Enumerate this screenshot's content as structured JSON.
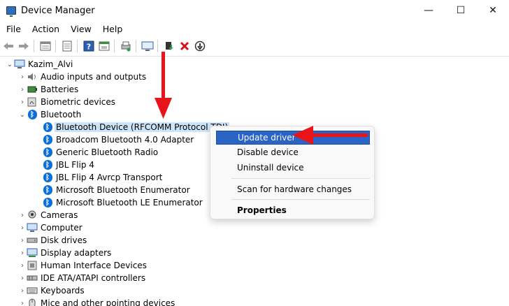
{
  "window": {
    "title": "Device Manager",
    "controls": {
      "minimize": "—",
      "maximize": "☐",
      "close": "✕"
    }
  },
  "menu": [
    "File",
    "Action",
    "View",
    "Help"
  ],
  "toolbar": {
    "icons": [
      "back-icon",
      "forward-icon",
      "properties-icon",
      "list-icon",
      "help-icon",
      "show-hidden-icon",
      "print-icon",
      "scan-icon",
      "update-driver-icon",
      "uninstall-icon",
      "enable-device-icon"
    ]
  },
  "tree": {
    "root": "Kazim_Alvi",
    "categories_top": [
      "Audio inputs and outputs",
      "Batteries",
      "Biometric devices"
    ],
    "bluetooth": "Bluetooth",
    "bluetooth_children": [
      "Bluetooth Device (RFCOMM Protocol TDI)",
      "Broadcom Bluetooth 4.0 Adapter",
      "Generic Bluetooth Radio",
      "JBL Flip 4",
      "JBL Flip 4 Avrcp Transport",
      "Microsoft Bluetooth Enumerator",
      "Microsoft Bluetooth LE Enumerator"
    ],
    "categories_bottom": [
      "Cameras",
      "Computer",
      "Disk drives",
      "Display adapters",
      "Human Interface Devices",
      "IDE ATA/ATAPI controllers",
      "Keyboards",
      "Mice and other pointing devices"
    ]
  },
  "context_menu": {
    "update": "Update driver",
    "disable": "Disable device",
    "uninstall": "Uninstall device",
    "scan": "Scan for hardware changes",
    "properties": "Properties"
  },
  "colors": {
    "selection": "#cce4f7",
    "highlight": "#2a64c5",
    "annotation_arrow": "#e8141a",
    "bluetooth_blue": "#0a6fd8"
  }
}
